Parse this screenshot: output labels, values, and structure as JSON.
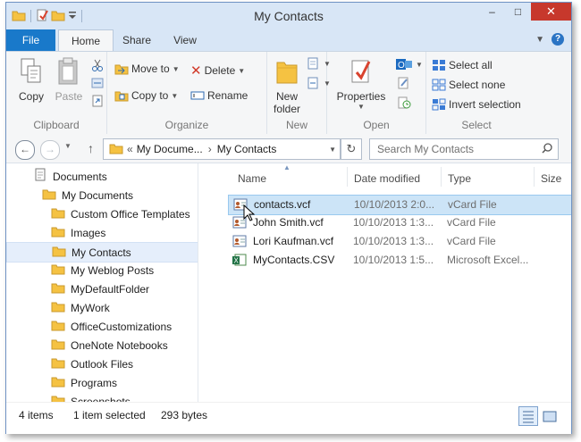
{
  "window": {
    "title": "My Contacts",
    "controls": {
      "minimize": "–",
      "maximize": "□",
      "close": "✕"
    }
  },
  "tabs": {
    "file": "File",
    "home": "Home",
    "share": "Share",
    "view": "View",
    "help": "?"
  },
  "ribbon": {
    "clipboard": {
      "label": "Clipboard",
      "copy": "Copy",
      "paste": "Paste"
    },
    "organize": {
      "label": "Organize",
      "move_to": "Move to",
      "copy_to": "Copy to",
      "delete": "Delete",
      "rename": "Rename"
    },
    "new": {
      "label": "New",
      "new_folder_line1": "New",
      "new_folder_line2": "folder"
    },
    "open": {
      "label": "Open",
      "properties": "Properties"
    },
    "select": {
      "label": "Select",
      "select_all": "Select all",
      "select_none": "Select none",
      "invert": "Invert selection"
    }
  },
  "address": {
    "prefix": "«",
    "crumb1": "My Docume...",
    "sep": "›",
    "crumb2": "My Contacts",
    "search_placeholder": "Search My Contacts"
  },
  "nav": {
    "items": [
      {
        "label": "Documents",
        "type": "library",
        "indent": 1
      },
      {
        "label": "My Documents",
        "type": "folder",
        "indent": 2
      },
      {
        "label": "Custom Office Templates",
        "type": "folder",
        "indent": 3
      },
      {
        "label": "Images",
        "type": "folder",
        "indent": 3
      },
      {
        "label": "My Contacts",
        "type": "folder",
        "indent": 3,
        "selected": true
      },
      {
        "label": "My Weblog Posts",
        "type": "folder",
        "indent": 3
      },
      {
        "label": "MyDefaultFolder",
        "type": "folder",
        "indent": 3
      },
      {
        "label": "MyWork",
        "type": "folder",
        "indent": 3
      },
      {
        "label": "OfficeCustomizations",
        "type": "folder",
        "indent": 3
      },
      {
        "label": "OneNote Notebooks",
        "type": "folder",
        "indent": 3
      },
      {
        "label": "Outlook Files",
        "type": "folder",
        "indent": 3
      },
      {
        "label": "Programs",
        "type": "folder",
        "indent": 3
      },
      {
        "label": "Screenshots",
        "type": "folder",
        "indent": 3
      }
    ]
  },
  "files": {
    "columns": {
      "name": "Name",
      "date": "Date modified",
      "type": "Type",
      "size": "Size"
    },
    "rows": [
      {
        "name": "contacts.vcf",
        "date": "10/10/2013 2:0...",
        "type": "vCard File",
        "icon": "vcard-icon",
        "selected": true
      },
      {
        "name": "John Smith.vcf",
        "date": "10/10/2013 1:3...",
        "type": "vCard File",
        "icon": "vcard-icon"
      },
      {
        "name": "Lori Kaufman.vcf",
        "date": "10/10/2013 1:3...",
        "type": "vCard File",
        "icon": "vcard-icon"
      },
      {
        "name": "MyContacts.CSV",
        "date": "10/10/2013 1:5...",
        "type": "Microsoft Excel...",
        "icon": "excel-csv-icon"
      }
    ]
  },
  "status": {
    "count": "4 items",
    "selection": "1 item selected",
    "size": "293 bytes"
  },
  "colors": {
    "accent": "#1979ca",
    "selection": "#cce4f7",
    "folder": "#f5c242"
  }
}
